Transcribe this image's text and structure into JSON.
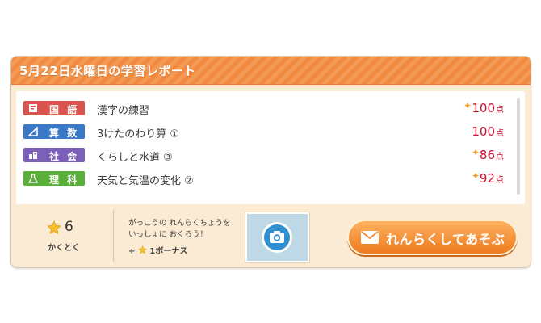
{
  "report": {
    "title": "5月22日水曜日の学習レポート"
  },
  "rows": [
    {
      "subject": "国 語",
      "lesson": "漢字の練習",
      "score": "100",
      "unit": "点",
      "sparkle": true,
      "color": "#d9534f",
      "icon": "notebook-icon"
    },
    {
      "subject": "算 数",
      "lesson": "3けたのわり算 ①",
      "score": "100",
      "unit": "点",
      "sparkle": false,
      "color": "#3a78c8",
      "icon": "triangle-ruler-icon"
    },
    {
      "subject": "社 会",
      "lesson": "くらしと水道 ③",
      "score": "86",
      "unit": "点",
      "sparkle": true,
      "color": "#7b5fb8",
      "icon": "building-icon"
    },
    {
      "subject": "理 科",
      "lesson": "天気と気温の変化 ②",
      "score": "92",
      "unit": "点",
      "sparkle": true,
      "color": "#5aae3a",
      "icon": "flask-icon"
    }
  ],
  "stars": {
    "count": "6",
    "label": "かくとく"
  },
  "message": {
    "line1": "がっこうの れんらくちょうを",
    "line2": "いっしょに おくろう！",
    "bonus": "+",
    "bonus_suffix": "1ボーナス"
  },
  "camera": {
    "icon": "camera-icon"
  },
  "cta": {
    "label": "れんらくしてあそぶ",
    "icon": "envelope-icon"
  },
  "colors": {
    "accent": "#f08a3e",
    "score": "#c8102e",
    "background": "#fbebd4"
  }
}
